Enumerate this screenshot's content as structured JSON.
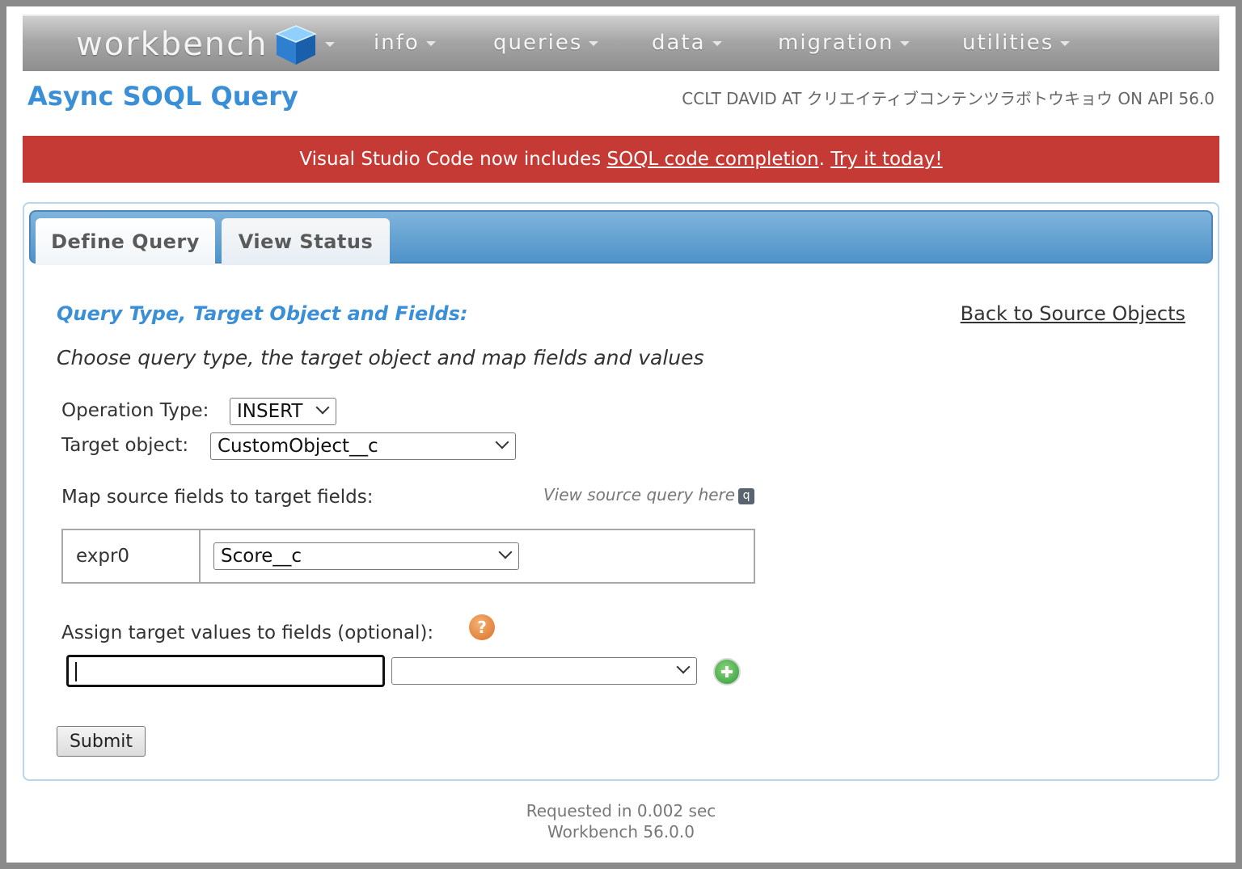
{
  "nav": {
    "logo": "workbench",
    "items": [
      {
        "label": "info"
      },
      {
        "label": "queries"
      },
      {
        "label": "data"
      },
      {
        "label": "migration"
      },
      {
        "label": "utilities"
      }
    ]
  },
  "header": {
    "title": "Async SOQL Query",
    "user_info": "CCLT DAVID AT クリエイティブコンテンツラボトウキョウ ON API 56.0"
  },
  "banner": {
    "text_before": "Visual Studio Code now includes ",
    "link1": "SOQL code completion",
    "text_between": ". ",
    "link2": "Try it today!"
  },
  "tabs": [
    {
      "label": "Define Query",
      "active": true
    },
    {
      "label": "View Status",
      "active": false
    }
  ],
  "form": {
    "heading": "Query Type, Target Object and Fields:",
    "back_link": "Back to Source Objects",
    "instructions": "Choose query type, the target object and map fields and values",
    "operation_label": "Operation Type:",
    "operation_value": "INSERT",
    "target_label": "Target object:",
    "target_value": "CustomObject__c",
    "map_label": "Map source fields to target fields:",
    "view_source": "View source query here",
    "view_source_icon": "q",
    "mapping": {
      "source": "expr0",
      "target": "Score__c"
    },
    "assign_label": "Assign target values to fields (optional):",
    "help_icon": "?",
    "value_input": "",
    "value_field_select": "",
    "submit": "Submit"
  },
  "footer": {
    "requested": "Requested in 0.002 sec",
    "version": "Workbench 56.0.0"
  },
  "colors": {
    "title": "#3a8fd6",
    "banner": "#c53a34",
    "tabbar": "#4f93c9"
  }
}
